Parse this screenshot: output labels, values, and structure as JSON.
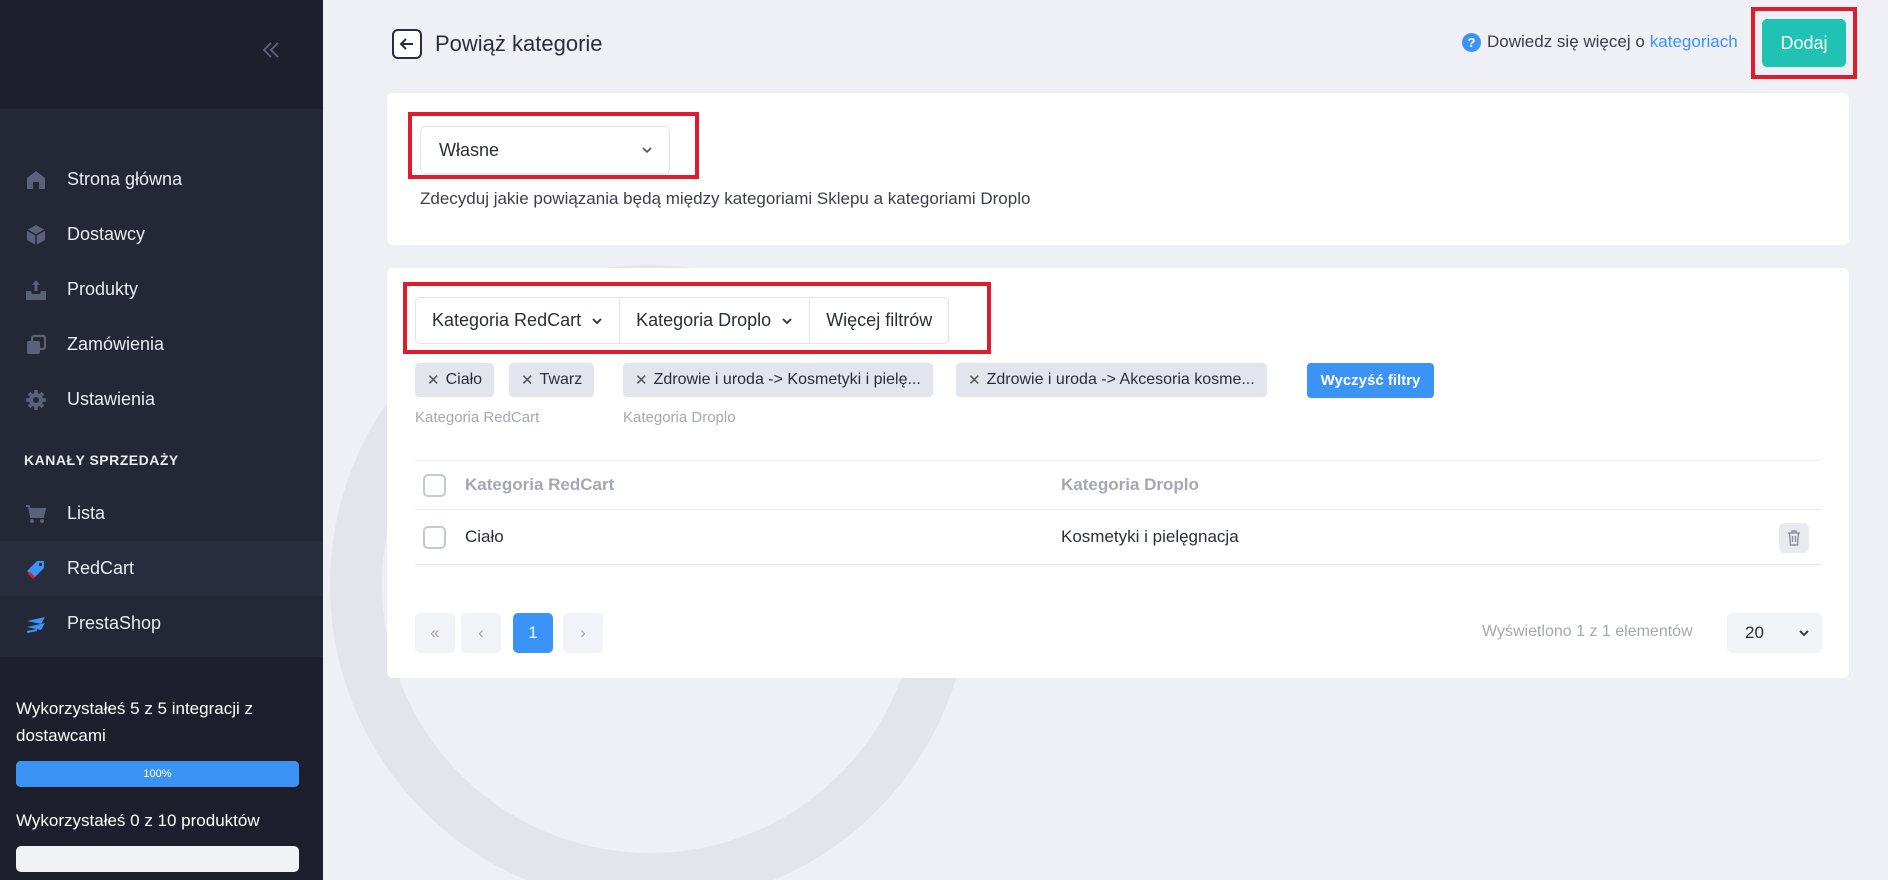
{
  "sidebar": {
    "nav": [
      {
        "label": "Strona główna",
        "icon": "home-icon"
      },
      {
        "label": "Dostawcy",
        "icon": "box-icon"
      },
      {
        "label": "Produkty",
        "icon": "upload-tray-icon"
      },
      {
        "label": "Zamówienia",
        "icon": "copy-icon"
      },
      {
        "label": "Ustawienia",
        "icon": "gear-icon"
      }
    ],
    "section_title": "KANAŁY SPRZEDAŻY",
    "channels": [
      {
        "label": "Lista",
        "icon": "cart-icon"
      },
      {
        "label": "RedCart",
        "icon": "tag-icon"
      },
      {
        "label": "PrestaShop",
        "icon": "prestashop-icon"
      }
    ],
    "usage": {
      "integrations_text": "Wykorzystałeś 5 z 5 integracji z dostawcami",
      "integrations_percent_label": "100%",
      "integrations_fraction": 1.0,
      "products_text": "Wykorzystałeś 0 z 10 produktów",
      "products_fraction": 0.0
    }
  },
  "header": {
    "title": "Powiąż kategorie",
    "help_text": "Dowiedz się więcej o",
    "help_link": "kategoriach",
    "add_label": "Dodaj"
  },
  "mapping": {
    "selected": "Własne",
    "description": "Zdecyduj jakie powiązania będą między kategoriami Sklepu a kategoriami Droplo"
  },
  "filters": {
    "buttons": [
      "Kategoria RedCart",
      "Kategoria Droplo",
      "Więcej filtrów"
    ],
    "chips_redcart": [
      "Ciało",
      "Twarz"
    ],
    "chips_droplo": [
      "Zdrowie i uroda -> Kosmetyki i pielę...",
      "Zdrowie i uroda -> Akcesoria kosme..."
    ],
    "caption_redcart": "Kategoria RedCart",
    "caption_droplo": "Kategoria Droplo",
    "clear_label": "Wyczyść filtry"
  },
  "table": {
    "columns": [
      "Kategoria RedCart",
      "Kategoria Droplo"
    ],
    "rows": [
      {
        "redcart": "Ciało",
        "droplo": "Kosmetyki i pielęgnacja"
      }
    ]
  },
  "pagination": {
    "first": "«",
    "prev": "‹",
    "current": "1",
    "next": "›",
    "shown_text": "Wyświetlono 1 z 1 elementów",
    "per_page": "20"
  },
  "colors": {
    "accent": "#3b93f5",
    "add_button": "#1fc2b3",
    "highlight": "#e01b2b",
    "sidebar": "#232736"
  }
}
